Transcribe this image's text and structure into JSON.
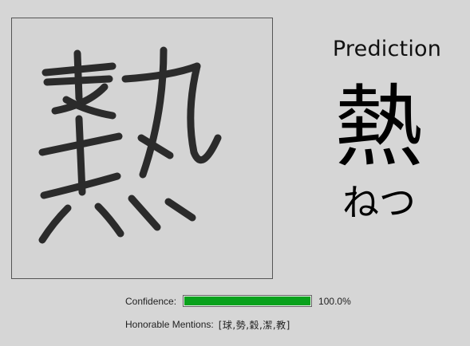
{
  "prediction": {
    "title": "Prediction",
    "kanji": "熱",
    "reading": "ねつ"
  },
  "confidence": {
    "label": "Confidence:",
    "value": 1.0,
    "value_text": "100.0%",
    "bar_color": "#09a21c"
  },
  "honorable_mentions": {
    "label": "Honorable Mentions:",
    "value": "[球,勢,穀,潔,教]"
  },
  "canvas": {
    "background": "#d4d4d4",
    "stroke_color": "#2b2b2b"
  }
}
